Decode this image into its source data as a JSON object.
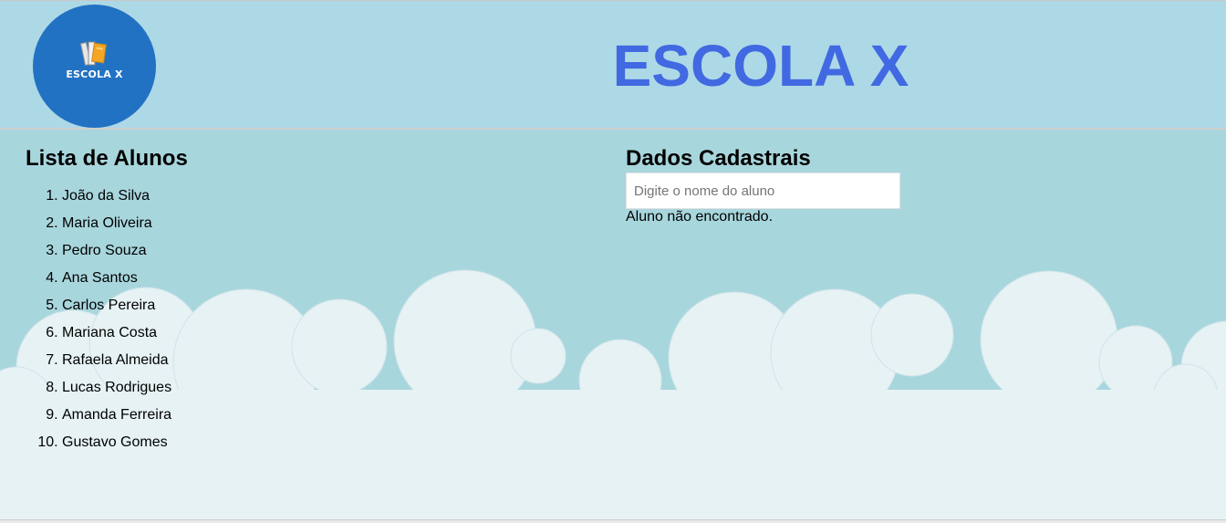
{
  "header": {
    "logo_text": "ESCOLA X",
    "title": "ESCOLA X"
  },
  "students": {
    "title": "Lista de Alunos",
    "items": [
      "João da Silva",
      "Maria Oliveira",
      "Pedro Souza",
      "Ana Santos",
      "Carlos Pereira",
      "Mariana Costa",
      "Rafaela Almeida",
      "Lucas Rodrigues",
      "Amanda Ferreira",
      "Gustavo Gomes"
    ]
  },
  "register": {
    "title": "Dados Cadastrais",
    "search_placeholder": "Digite o nome do aluno",
    "search_value": "",
    "status": "Aluno não encontrado."
  },
  "colors": {
    "header_bg": "#add8e6",
    "body_bg": "#a8d6dd",
    "logo_bg": "#2272c3",
    "title_color": "#4169e1",
    "cloud_color": "#e6f2f4"
  },
  "icons": {
    "logo": "books-icon"
  }
}
